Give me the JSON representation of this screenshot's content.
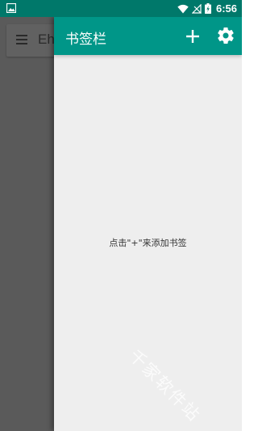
{
  "status_bar": {
    "time": "6:56",
    "battery_level": "⚡",
    "icons": [
      "gallery-icon",
      "wifi-icon",
      "no-signal-icon",
      "battery-charging-icon"
    ]
  },
  "background_app": {
    "search_text": "Eh"
  },
  "drawer": {
    "title": "书签栏",
    "empty_hint": "点击\"+\"来添加书签",
    "add_icon": "add-icon",
    "settings_icon": "settings-icon"
  },
  "watermark": {
    "text": "千家软件站"
  },
  "colors": {
    "status_bar": "#00786a",
    "toolbar": "#009688",
    "drawer_bg": "#eeeeee",
    "scrim": "#5a5a5a"
  }
}
